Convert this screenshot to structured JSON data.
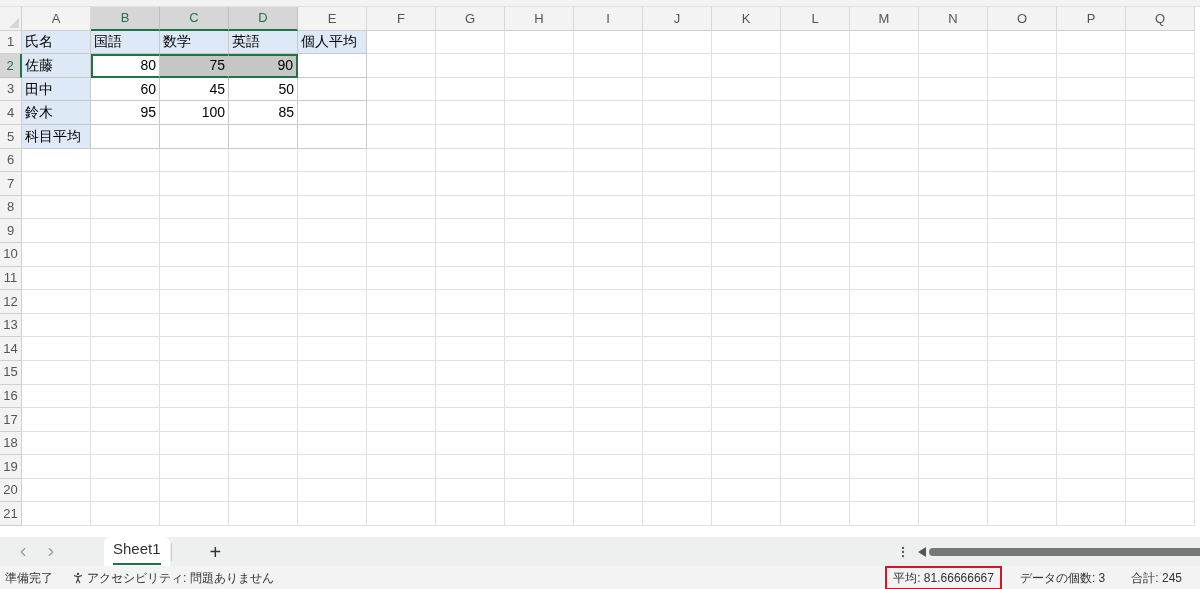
{
  "columns": [
    {
      "label": "A",
      "selected": false
    },
    {
      "label": "B",
      "selected": true
    },
    {
      "label": "C",
      "selected": true
    },
    {
      "label": "D",
      "selected": true
    },
    {
      "label": "E",
      "selected": false
    },
    {
      "label": "F",
      "selected": false
    },
    {
      "label": "G",
      "selected": false
    },
    {
      "label": "H",
      "selected": false
    },
    {
      "label": "I",
      "selected": false
    },
    {
      "label": "J",
      "selected": false
    },
    {
      "label": "K",
      "selected": false
    },
    {
      "label": "L",
      "selected": false
    },
    {
      "label": "M",
      "selected": false
    },
    {
      "label": "N",
      "selected": false
    },
    {
      "label": "O",
      "selected": false
    },
    {
      "label": "P",
      "selected": false
    },
    {
      "label": "Q",
      "selected": false
    }
  ],
  "rows": [
    {
      "label": "1",
      "selected": false,
      "cells": [
        {
          "text": "氏名",
          "kind": "label",
          "selected": false
        },
        {
          "text": "国語",
          "kind": "label",
          "selected": false
        },
        {
          "text": "数学",
          "kind": "label",
          "selected": false
        },
        {
          "text": "英語",
          "kind": "label",
          "selected": false
        },
        {
          "text": "個人平均",
          "kind": "label",
          "selected": false
        }
      ]
    },
    {
      "label": "2",
      "selected": true,
      "cells": [
        {
          "text": "佐藤",
          "kind": "label",
          "selected": false
        },
        {
          "text": "80",
          "kind": "number",
          "selected": true,
          "active": true
        },
        {
          "text": "75",
          "kind": "number",
          "selected": true,
          "active": false
        },
        {
          "text": "90",
          "kind": "number",
          "selected": true,
          "active": false
        },
        {
          "kind": "blank",
          "selected": false
        }
      ]
    },
    {
      "label": "3",
      "selected": false,
      "cells": [
        {
          "text": "田中",
          "kind": "label",
          "selected": false
        },
        {
          "text": "60",
          "kind": "number",
          "selected": false
        },
        {
          "text": "45",
          "kind": "number",
          "selected": false
        },
        {
          "text": "50",
          "kind": "number",
          "selected": false
        },
        {
          "kind": "blank",
          "selected": false
        }
      ]
    },
    {
      "label": "4",
      "selected": false,
      "cells": [
        {
          "text": "鈴木",
          "kind": "label",
          "selected": false
        },
        {
          "text": "95",
          "kind": "number",
          "selected": false
        },
        {
          "text": "100",
          "kind": "number",
          "selected": false
        },
        {
          "text": "85",
          "kind": "number",
          "selected": false
        },
        {
          "kind": "blank",
          "selected": false
        }
      ]
    },
    {
      "label": "5",
      "selected": false,
      "cells": [
        {
          "text": "科目平均",
          "kind": "label",
          "selected": false
        },
        {
          "kind": "blank",
          "selected": false
        },
        {
          "kind": "blank",
          "selected": false
        },
        {
          "kind": "blank",
          "selected": false
        },
        {
          "kind": "blank",
          "selected": false
        }
      ]
    },
    {
      "label": "6",
      "selected": false
    },
    {
      "label": "7",
      "selected": false
    },
    {
      "label": "8",
      "selected": false
    },
    {
      "label": "9",
      "selected": false
    },
    {
      "label": "10",
      "selected": false
    },
    {
      "label": "11",
      "selected": false
    },
    {
      "label": "12",
      "selected": false
    },
    {
      "label": "13",
      "selected": false
    },
    {
      "label": "14",
      "selected": false
    },
    {
      "label": "15",
      "selected": false
    },
    {
      "label": "16",
      "selected": false
    },
    {
      "label": "17",
      "selected": false
    },
    {
      "label": "18",
      "selected": false
    },
    {
      "label": "19",
      "selected": false
    },
    {
      "label": "20",
      "selected": false
    },
    {
      "label": "21",
      "selected": false
    }
  ],
  "sheet_tabs": [
    {
      "label": "Sheet1",
      "selected": true
    }
  ],
  "add_sheet": "+",
  "status_bar": {
    "ready": "準備完了",
    "accessibility": "アクセシビリティ: 問題ありません",
    "stats": [
      {
        "text": "平均: 81.66666667",
        "highlighted": true
      },
      {
        "text": "データの個数: 3",
        "highlighted": false
      },
      {
        "text": "合計: 245",
        "highlighted": false
      }
    ]
  }
}
